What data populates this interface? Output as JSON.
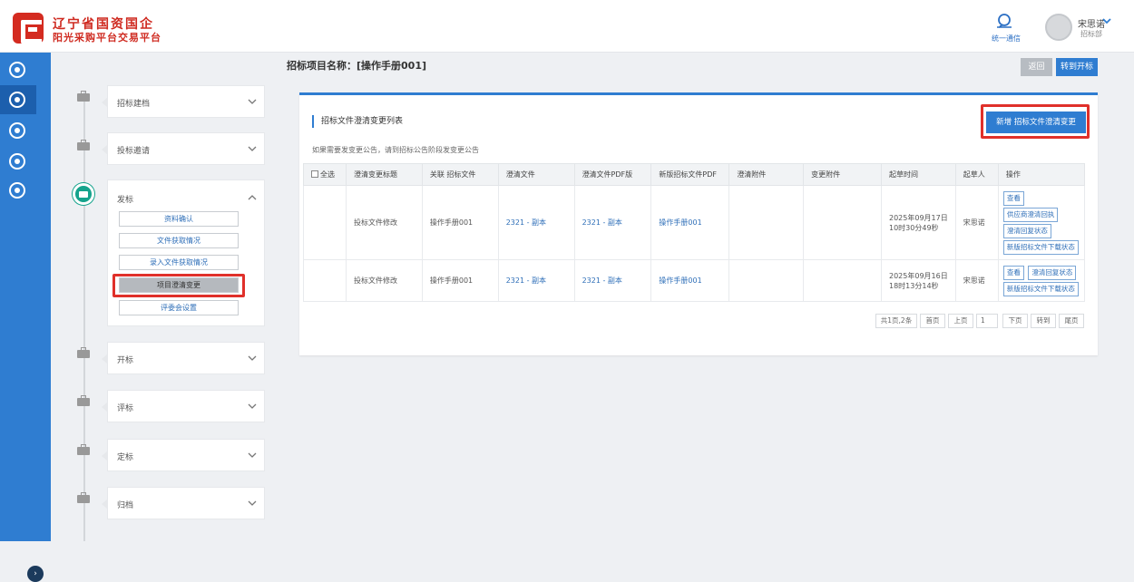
{
  "header": {
    "brand_line1": "辽宁省国资国企",
    "brand_line2": "阳光采购平台交易平台",
    "msg_label": "统一通信",
    "user_name": "宋思诺",
    "user_dept": "招标部"
  },
  "page": {
    "title": "招标项目名称：[操作手册001]",
    "back_label": "返回",
    "goto_label": "转到开标"
  },
  "steps": [
    {
      "label": "招标建档"
    },
    {
      "label": "投标邀请"
    },
    {
      "label": "发标"
    },
    {
      "label": "开标"
    },
    {
      "label": "评标"
    },
    {
      "label": "定标"
    },
    {
      "label": "归档"
    }
  ],
  "sub_items": [
    "资料确认",
    "文件获取情况",
    "录入文件获取情况",
    "项目澄清变更",
    "评委会设置"
  ],
  "list": {
    "title": "招标文件澄清变更列表",
    "notice": "如果需要发变更公告，请到招标公告阶段发变更公告",
    "add_label": "新增 招标文件澄清变更",
    "columns": [
      "全选",
      "澄清变更标题",
      "关联 招标文件",
      "澄清文件",
      "澄清文件PDF版",
      "新版招标文件PDF",
      "澄清附件",
      "变更附件",
      "起草时间",
      "起草人",
      "操作"
    ],
    "rows": [
      {
        "title": "投标文件修改",
        "doc": "操作手册001",
        "clar": "2321 - 副本",
        "clar_pdf": "2321 - 副本",
        "new_pdf": "操作手册001",
        "time1": "2025年09月17日",
        "time2": "10时30分49秒",
        "author": "宋思诺",
        "ops": [
          "查看",
          "供应商澄清回执",
          "澄清回复状态",
          "新版招标文件下载状态"
        ]
      },
      {
        "title": "投标文件修改",
        "doc": "操作手册001",
        "clar": "2321 - 副本",
        "clar_pdf": "2321 - 副本",
        "new_pdf": "操作手册001",
        "time1": "2025年09月16日",
        "time2": "18时13分14秒",
        "author": "宋思诺",
        "ops": [
          "查看",
          "澄清回复状态",
          "新版招标文件下载状态"
        ]
      }
    ]
  },
  "pager": {
    "info": "共1页,2条",
    "first": "首页",
    "prev": "上页",
    "page": "1",
    "next": "下页",
    "goto": "转到",
    "last": "尾页"
  },
  "colors": {
    "primary": "#2f7dd1",
    "highlight": "#e0302a",
    "brand": "#cf2a20",
    "active_step": "#15a38c"
  }
}
